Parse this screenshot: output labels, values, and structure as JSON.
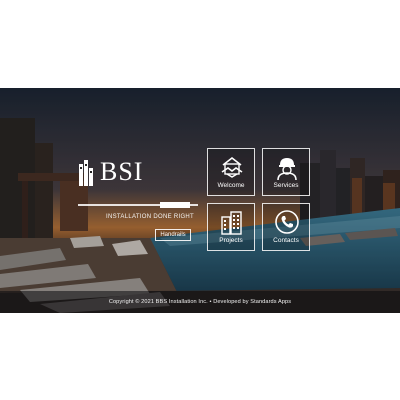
{
  "brand": {
    "logo_text": "BSI",
    "tagline": "INSTALLATION DONE RIGHT",
    "sub_button": "Handrails"
  },
  "tiles": [
    {
      "label": "Welcome",
      "icon": "handshake-house-icon"
    },
    {
      "label": "Services",
      "icon": "worker-helmet-icon"
    },
    {
      "label": "Projects",
      "icon": "buildings-icon"
    },
    {
      "label": "Contacts",
      "icon": "phone-icon"
    }
  ],
  "footer": {
    "text": "Copyright © 2021 BBS Installation Inc. • Developed by Standards Apps"
  },
  "colors": {
    "background": "#ffffff",
    "overlay_text": "#ffffff",
    "sky_top": "#1e2838",
    "sunset": "#7a4e2e"
  }
}
